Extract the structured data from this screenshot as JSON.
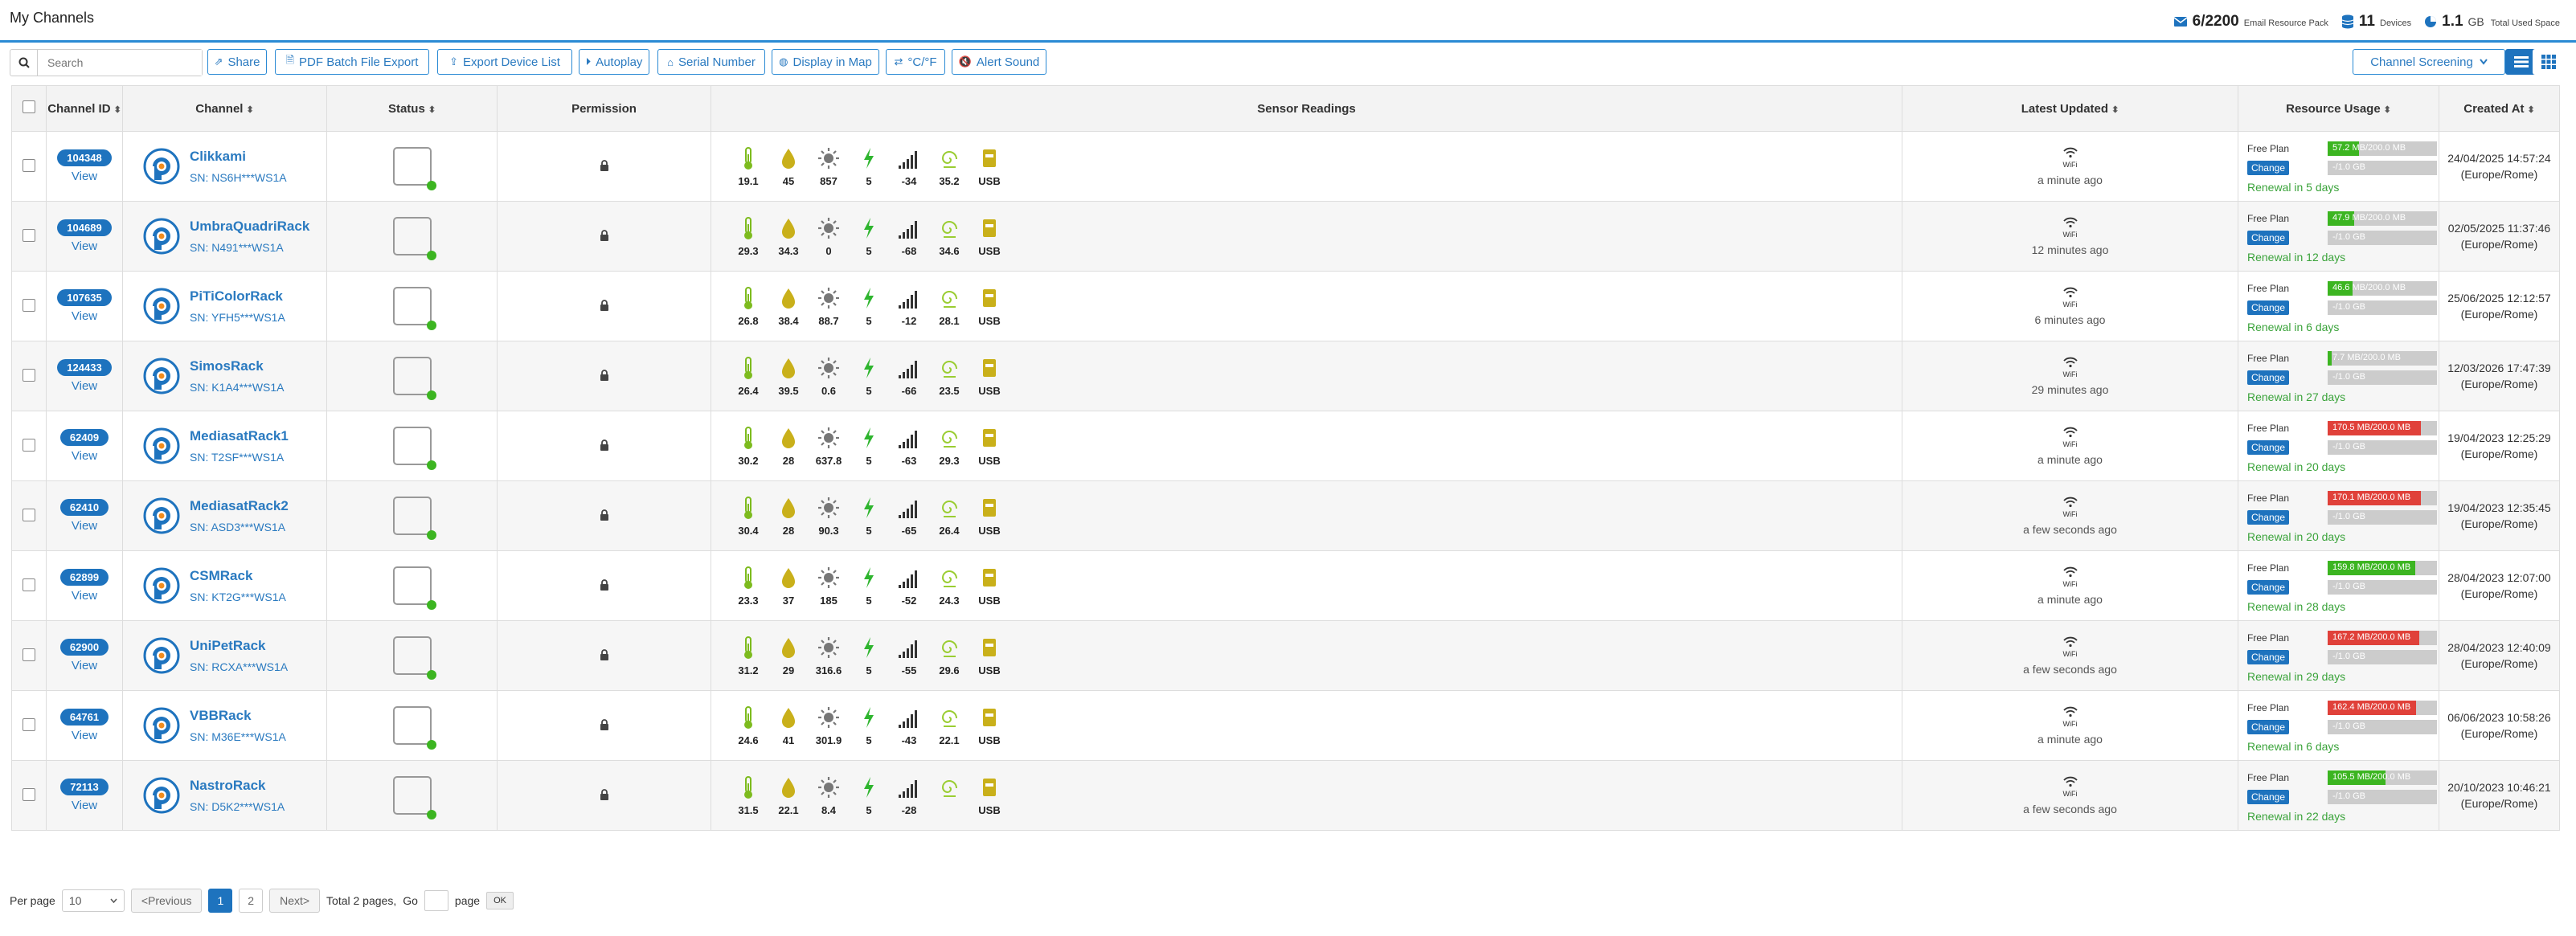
{
  "header": {
    "title": "My Channels",
    "email_count": "6/2200",
    "email_label": "Email Resource Pack",
    "devices_count": "11",
    "devices_label": "Devices",
    "space_value": "1.1",
    "space_unit": "GB",
    "space_label": "Total Used Space"
  },
  "toolbar": {
    "search_placeholder": "Search",
    "buttons": [
      {
        "label": "Share",
        "icon": "share-icon"
      },
      {
        "label": "PDF Batch File Export",
        "icon": "file-icon"
      },
      {
        "label": "Export Device List",
        "icon": "export-icon"
      },
      {
        "label": "Autoplay",
        "icon": "play-icon"
      },
      {
        "label": "Serial Number",
        "icon": "tag-icon"
      },
      {
        "label": "Display in Map",
        "icon": "globe-icon"
      },
      {
        "label": "°C/°F",
        "icon": "swap-icon"
      },
      {
        "label": "Alert Sound",
        "icon": "mute-icon"
      }
    ],
    "screening_label": "Channel Screening"
  },
  "table": {
    "headers": {
      "channel_id": "Channel ID",
      "channel": "Channel",
      "status": "Status",
      "permission": "Permission",
      "sensor_readings": "Sensor Readings",
      "latest_updated": "Latest Updated",
      "resource_usage": "Resource Usage",
      "created_at": "Created At"
    },
    "view_label": "View",
    "wifi_label": "WiFi",
    "plan_label": "Free Plan",
    "change_label": "Change",
    "gb_label": "-/1.0 GB",
    "rows": [
      {
        "id": "104348",
        "name": "Clikkami",
        "sn": "SN: NS6H***WS1A",
        "readings": [
          "19.1",
          "45",
          "857",
          "5",
          "-34",
          "35.2",
          "USB"
        ],
        "updated": "a minute ago",
        "mb": "57.2 MB/200.0 MB",
        "mb_ratio": 0.29,
        "mb_color": "#3cb521",
        "renewal": "Renewal in 5 days",
        "created": "24/04/2025 14:57:24",
        "tz": "(Europe/Rome)"
      },
      {
        "id": "104689",
        "name": "UmbraQuadriRack",
        "sn": "SN: N491***WS1A",
        "readings": [
          "29.3",
          "34.3",
          "0",
          "5",
          "-68",
          "34.6",
          "USB"
        ],
        "updated": "12 minutes ago",
        "mb": "47.9 MB/200.0 MB",
        "mb_ratio": 0.24,
        "mb_color": "#3cb521",
        "renewal": "Renewal in 12 days",
        "created": "02/05/2025 11:37:46",
        "tz": "(Europe/Rome)"
      },
      {
        "id": "107635",
        "name": "PiTiColorRack",
        "sn": "SN: YFH5***WS1A",
        "readings": [
          "26.8",
          "38.4",
          "88.7",
          "5",
          "-12",
          "28.1",
          "USB"
        ],
        "updated": "6 minutes ago",
        "mb": "46.6 MB/200.0 MB",
        "mb_ratio": 0.23,
        "mb_color": "#3cb521",
        "renewal": "Renewal in 6 days",
        "created": "25/06/2025 12:12:57",
        "tz": "(Europe/Rome)"
      },
      {
        "id": "124433",
        "name": "SimosRack",
        "sn": "SN: K1A4***WS1A",
        "readings": [
          "26.4",
          "39.5",
          "0.6",
          "5",
          "-66",
          "23.5",
          "USB"
        ],
        "updated": "29 minutes ago",
        "mb": "7.7 MB/200.0 MB",
        "mb_ratio": 0.04,
        "mb_color": "#3cb521",
        "renewal": "Renewal in 27 days",
        "created": "12/03/2026 17:47:39",
        "tz": "(Europe/Rome)"
      },
      {
        "id": "62409",
        "name": "MediasatRack1",
        "sn": "SN: T2SF***WS1A",
        "readings": [
          "30.2",
          "28",
          "637.8",
          "5",
          "-63",
          "29.3",
          "USB"
        ],
        "updated": "a minute ago",
        "mb": "170.5 MB/200.0 MB",
        "mb_ratio": 0.85,
        "mb_color": "#e0413a",
        "renewal": "Renewal in 20 days",
        "created": "19/04/2023 12:25:29",
        "tz": "(Europe/Rome)"
      },
      {
        "id": "62410",
        "name": "MediasatRack2",
        "sn": "SN: ASD3***WS1A",
        "readings": [
          "30.4",
          "28",
          "90.3",
          "5",
          "-65",
          "26.4",
          "USB"
        ],
        "updated": "a few seconds ago",
        "mb": "170.1 MB/200.0 MB",
        "mb_ratio": 0.85,
        "mb_color": "#e0413a",
        "renewal": "Renewal in 20 days",
        "created": "19/04/2023 12:35:45",
        "tz": "(Europe/Rome)"
      },
      {
        "id": "62899",
        "name": "CSMRack",
        "sn": "SN: KT2G***WS1A",
        "readings": [
          "23.3",
          "37",
          "185",
          "5",
          "-52",
          "24.3",
          "USB"
        ],
        "updated": "a minute ago",
        "mb": "159.8 MB/200.0 MB",
        "mb_ratio": 0.8,
        "mb_color": "#3cb521",
        "renewal": "Renewal in 28 days",
        "created": "28/04/2023 12:07:00",
        "tz": "(Europe/Rome)"
      },
      {
        "id": "62900",
        "name": "UniPetRack",
        "sn": "SN: RCXA***WS1A",
        "readings": [
          "31.2",
          "29",
          "316.6",
          "5",
          "-55",
          "29.6",
          "USB"
        ],
        "updated": "a few seconds ago",
        "mb": "167.2 MB/200.0 MB",
        "mb_ratio": 0.84,
        "mb_color": "#e0413a",
        "renewal": "Renewal in 29 days",
        "created": "28/04/2023 12:40:09",
        "tz": "(Europe/Rome)"
      },
      {
        "id": "64761",
        "name": "VBBRack",
        "sn": "SN: M36E***WS1A",
        "readings": [
          "24.6",
          "41",
          "301.9",
          "5",
          "-43",
          "22.1",
          "USB"
        ],
        "updated": "a minute ago",
        "mb": "162.4 MB/200.0 MB",
        "mb_ratio": 0.81,
        "mb_color": "#e0413a",
        "renewal": "Renewal in 6 days",
        "created": "06/06/2023 10:58:26",
        "tz": "(Europe/Rome)"
      },
      {
        "id": "72113",
        "name": "NastroRack",
        "sn": "SN: D5K2***WS1A",
        "readings": [
          "31.5",
          "22.1",
          "8.4",
          "5",
          "-28",
          "",
          "USB"
        ],
        "updated": "a few seconds ago",
        "mb": "105.5 MB/200.0 MB",
        "mb_ratio": 0.53,
        "mb_color": "#3cb521",
        "renewal": "Renewal in 22 days",
        "created": "20/10/2023 10:46:21",
        "tz": "(Europe/Rome)"
      }
    ]
  },
  "pagination": {
    "per_page_label": "Per page",
    "per_page_value": "10",
    "prev_label": "<Previous",
    "pages": [
      "1",
      "2"
    ],
    "next_label": "Next>",
    "total_label": "Total 2 pages,",
    "go_label": "Go",
    "page_label": "page",
    "ok_label": "OK"
  },
  "colors": {
    "accent": "#1e73be",
    "ok_green": "#3cb521",
    "warn_red": "#e0413a"
  }
}
